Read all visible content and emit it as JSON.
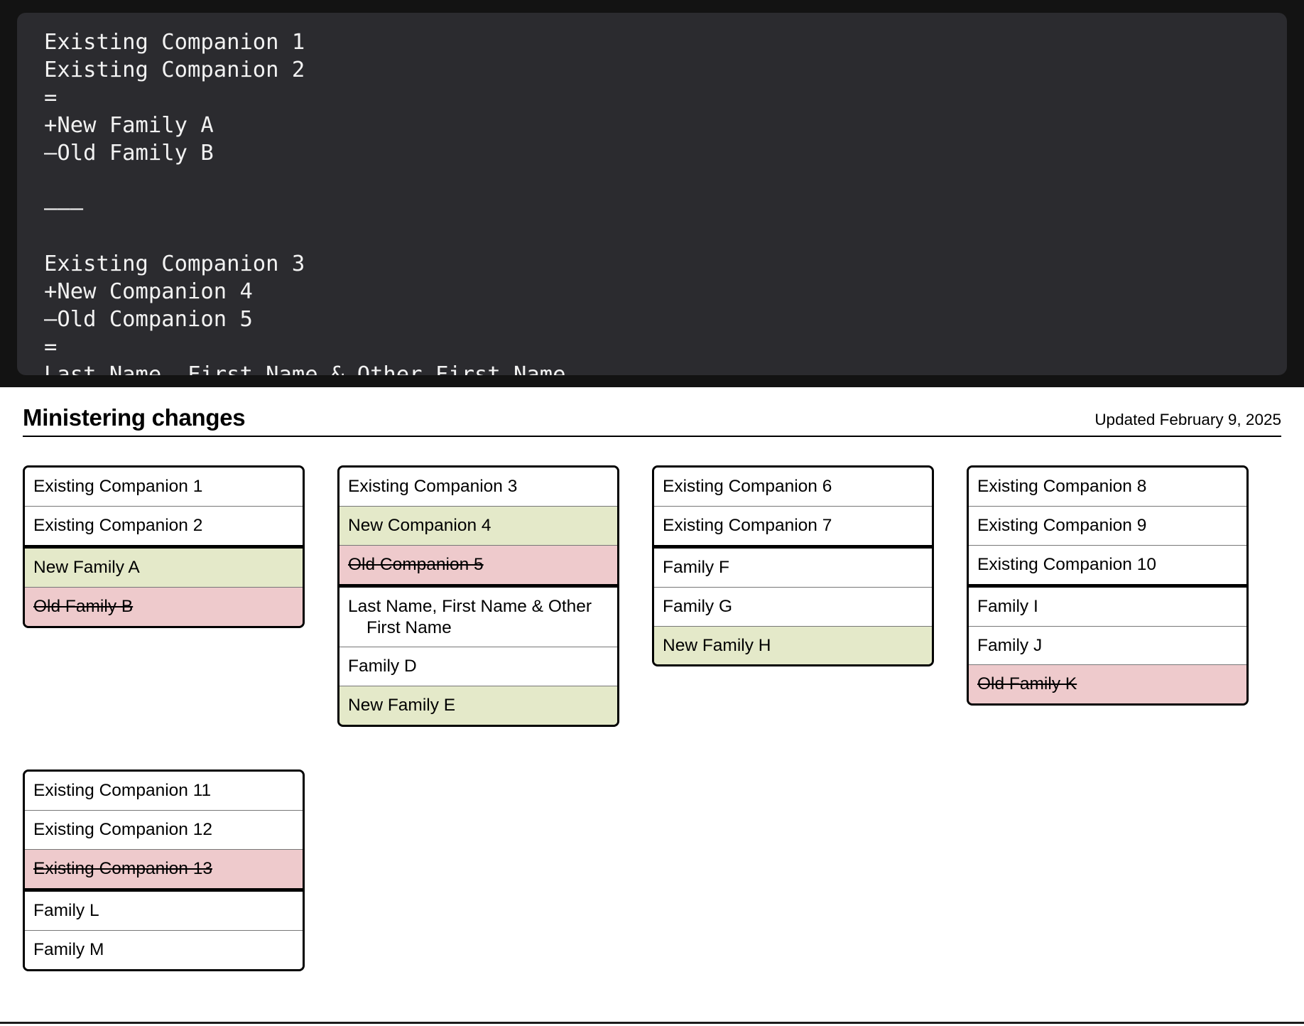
{
  "code_panel": {
    "text": "Existing Companion 1\nExisting Companion 2\n=\n+New Family A\n–Old Family B\n\n———\n\nExisting Companion 3\n+New Companion 4\n–Old Companion 5\n=\nLast Name, First Name & Other First Name"
  },
  "header": {
    "title": "Ministering changes",
    "updated": "Updated February 9, 2025"
  },
  "colors": {
    "new_highlight": "#e4e9c9",
    "removed_highlight": "#eecacc",
    "border": "#000000",
    "panel_background": "#2b2b2f",
    "page_background": "#ffffff"
  },
  "cards": [
    {
      "name": "companionship-1",
      "rows": [
        {
          "text": "Existing Companion 1",
          "state": "normal",
          "section_start": false
        },
        {
          "text": "Existing Companion 2",
          "state": "normal",
          "section_start": false
        },
        {
          "text": "New Family A",
          "state": "new",
          "section_start": true
        },
        {
          "text": "Old Family B",
          "state": "removed",
          "section_start": false
        }
      ]
    },
    {
      "name": "companionship-2",
      "rows": [
        {
          "text": "Existing Companion 3",
          "state": "normal",
          "section_start": false
        },
        {
          "text": "New Companion 4",
          "state": "new",
          "section_start": false
        },
        {
          "text": "Old Companion 5",
          "state": "removed",
          "section_start": false
        },
        {
          "text": "Last Name, First Name & Other First Name",
          "state": "normal",
          "section_start": true
        },
        {
          "text": "Family D",
          "state": "normal",
          "section_start": false
        },
        {
          "text": "New Family E",
          "state": "new",
          "section_start": false
        }
      ]
    },
    {
      "name": "companionship-3",
      "rows": [
        {
          "text": "Existing Companion 6",
          "state": "normal",
          "section_start": false
        },
        {
          "text": "Existing Companion 7",
          "state": "normal",
          "section_start": false
        },
        {
          "text": "Family F",
          "state": "normal",
          "section_start": true
        },
        {
          "text": "Family G",
          "state": "normal",
          "section_start": false
        },
        {
          "text": "New Family H",
          "state": "new",
          "section_start": false
        }
      ]
    },
    {
      "name": "companionship-4",
      "rows": [
        {
          "text": "Existing Companion 8",
          "state": "normal",
          "section_start": false
        },
        {
          "text": "Existing Companion 9",
          "state": "normal",
          "section_start": false
        },
        {
          "text": "Existing Companion 10",
          "state": "normal",
          "section_start": false
        },
        {
          "text": "Family I",
          "state": "normal",
          "section_start": true
        },
        {
          "text": "Family J",
          "state": "normal",
          "section_start": false
        },
        {
          "text": "Old Family K",
          "state": "removed",
          "section_start": false
        }
      ]
    },
    {
      "name": "companionship-5",
      "rows": [
        {
          "text": "Existing Companion 11",
          "state": "normal",
          "section_start": false
        },
        {
          "text": "Existing Companion 12",
          "state": "normal",
          "section_start": false
        },
        {
          "text": "Existing Companion 13",
          "state": "removed",
          "section_start": false
        },
        {
          "text": "Family L",
          "state": "normal",
          "section_start": true
        },
        {
          "text": "Family M",
          "state": "normal",
          "section_start": false
        }
      ]
    }
  ]
}
